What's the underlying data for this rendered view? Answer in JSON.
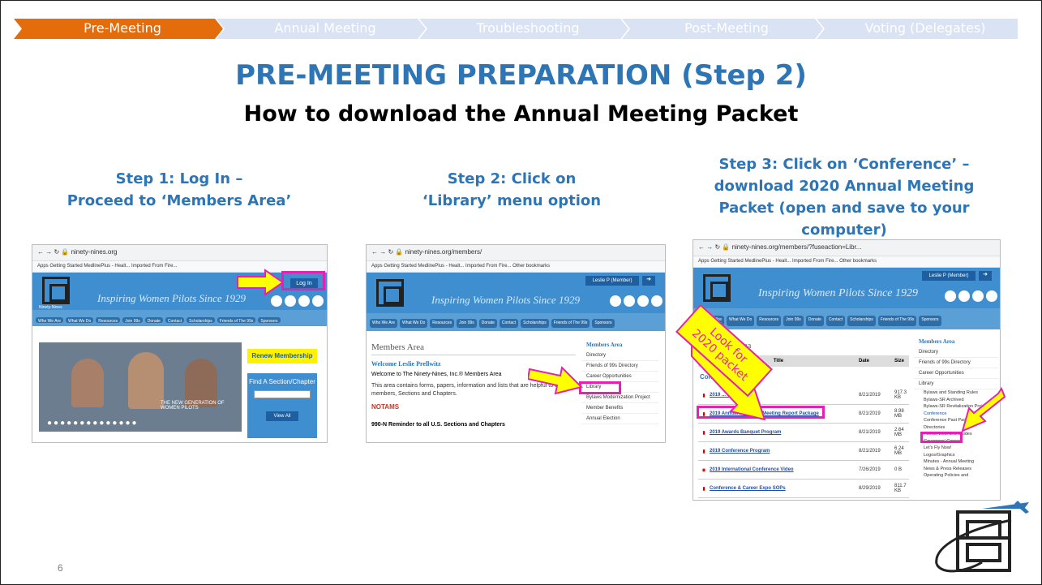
{
  "nav": {
    "tabs": [
      {
        "label": "Pre-Meeting",
        "color": "#e46c0a",
        "active": true
      },
      {
        "label": "Annual Meeting",
        "color": "#dae3f3",
        "active": false
      },
      {
        "label": "Troubleshooting",
        "color": "#dae3f3",
        "active": false
      },
      {
        "label": "Post-Meeting",
        "color": "#dae3f3",
        "active": false
      },
      {
        "label": "Voting (Delegates)",
        "color": "#dae3f3",
        "active": false
      }
    ]
  },
  "title": "PRE-MEETING PREPARATION (Step 2)",
  "subtitle": "How to download the Annual Meeting Packet",
  "steps": [
    {
      "line1": "Step 1: Log In –",
      "line2": "Proceed to ‘Members Area’"
    },
    {
      "line1": "Step 2: Click on",
      "line2": "‘Library’ menu option"
    },
    {
      "line1": "Step 3: Click on ‘Conference’ –",
      "line2": "download 2020 Annual Meeting",
      "line3": "Packet (open and save to your",
      "line4": "computer)"
    }
  ],
  "page_number": "6",
  "colors": {
    "accent": "#2e75b6",
    "highlight": "#e81fb4",
    "arrow": "#ffff00",
    "site_blue": "#3f8fd0"
  },
  "shot1": {
    "url": "ninety-nines.org",
    "bookmarks": "Apps   Getting Started   MedlinePlus - Healt...   Imported From Fire...",
    "tagline": "Inspiring Women Pilots Since 1929",
    "login": "Log In",
    "menu": [
      "Who We Are",
      "What We Do",
      "Resources",
      "Join 99s",
      "Donate",
      "Contact",
      "Scholarships",
      "Friends of The 99s",
      "Sponsors"
    ],
    "renew": "Renew Membership",
    "find": "Find A Section/Chapter",
    "view_all": "View All",
    "banner_text": "THE NEW GENERATION OF WOMEN PILOTS",
    "logo_text": "Ninety-Nines"
  },
  "shot2": {
    "url": "ninety-nines.org/members/",
    "bookmarks": "Apps   Getting Started   MedlinePlus - Healt...   Imported From Fire...          Other bookmarks",
    "tagline": "Inspiring Women Pilots Since 1929",
    "member": "Leslie P (Member)",
    "menu": [
      "Who We Are",
      "What We Do",
      "Resources",
      "Join 99s",
      "Donate",
      "Contact",
      "Scholarships",
      "Friends of The 99s",
      "Sponsors"
    ],
    "heading": "Members Area",
    "welcome": "Welcome Leslie Prellwitz",
    "welcome2": "Welcome to The Ninety-Nines, Inc.® Members Area",
    "body": "This area contains forms, papers, information and lists that are helpful to our members, Sections and Chapters.",
    "notams": "NOTAMS",
    "reminder": "990-N Reminder to all U.S. Sections and Chapters",
    "side_title": "Members Area",
    "side": [
      "Directory",
      "Friends of 99s Directory",
      "Career Opportunities",
      "Library",
      "Bylaws Modernization Project",
      "Member Benefits",
      "Annual Election"
    ]
  },
  "shot3": {
    "url": "ninety-nines.org/members/?fuseaction=Libr...",
    "bookmarks": "Apps   Getting Started   MedlinePlus - Healt...   Imported From Fire...          Other bookmarks",
    "tagline": "Inspiring Women Pilots Since 1929",
    "member": "Leslie P (Member)",
    "menu": [
      "Who We Are",
      "What We Do",
      "Resources",
      "Join 99s",
      "Donate",
      "Contact",
      "Scholarships",
      "Friends of The 99s",
      "Sponsors"
    ],
    "area": "Area",
    "cols": [
      "Title",
      "Date",
      "Size"
    ],
    "conf": "Conf",
    "rows": [
      {
        "t": "2019 ... Program",
        "d": "8/21/2019",
        "s": "917.3 KB"
      },
      {
        "t": "2019 Annual Business Meeting Report Package",
        "d": "8/21/2019",
        "s": "8.98 MB"
      },
      {
        "t": "2019 Awards Banquet Program",
        "d": "8/21/2019",
        "s": "2.64 MB"
      },
      {
        "t": "2019 Conference Program",
        "d": "8/21/2019",
        "s": "6.24 MB"
      },
      {
        "t": "2019 International Conference Video",
        "d": "7/26/2019",
        "s": "0 B"
      },
      {
        "t": "Conference & Career Expo SOPs",
        "d": "8/29/2019",
        "s": "811.7 KB"
      }
    ],
    "sticky": "Look for 2020 packet",
    "side_title": "Members Area",
    "side": [
      "Directory",
      "Friends of 99s Directory",
      "Career Opportunities",
      "Library"
    ],
    "lib": [
      "Bylaws and Standing Rules",
      "Bylaws-SR Archived",
      "Bylaws-SR Revitalization Project",
      "Conference",
      "Conference Past Packages",
      "Directories",
      "Forms, Lists and Guides",
      "Governors' Corner",
      "Let's Fly Now!",
      "Logos/Graphics",
      "Minutes - Annual Meeting",
      "News & Press Releases",
      "Operating Policies and"
    ]
  }
}
